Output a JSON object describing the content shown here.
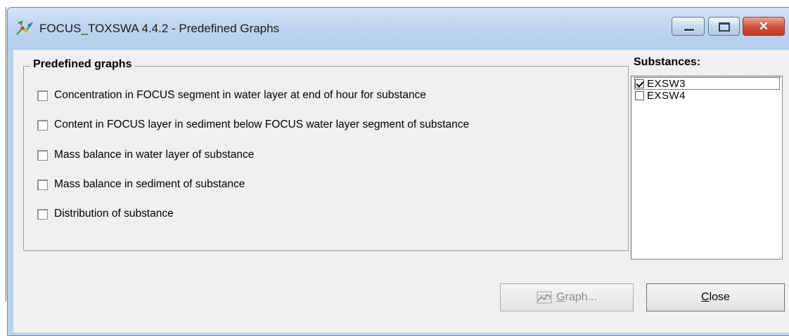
{
  "window": {
    "title": "FOCUS_TOXSWA 4.4.2 - Predefined Graphs",
    "controls": {
      "minimize": "minimize",
      "maximize": "maximize",
      "close": "✕"
    }
  },
  "predefined": {
    "group_label": "Predefined graphs",
    "options": [
      {
        "label": "Concentration in FOCUS segment in water layer at end of hour for substance",
        "checked": false
      },
      {
        "label": "Content in FOCUS layer in sediment below FOCUS water layer segment of substance",
        "checked": false
      },
      {
        "label": "Mass balance in water layer of substance",
        "checked": false
      },
      {
        "label": "Mass balance in sediment of substance",
        "checked": false
      },
      {
        "label": "Distribution of substance",
        "checked": false
      }
    ]
  },
  "substances": {
    "title": "Substances:",
    "items": [
      {
        "label": "EXSW3",
        "checked": true
      },
      {
        "label": "EXSW4",
        "checked": false
      }
    ]
  },
  "buttons": {
    "graph": {
      "mnemonic": "G",
      "rest": "raph...",
      "enabled": false
    },
    "close": {
      "mnemonic": "C",
      "rest": "lose",
      "enabled": true
    }
  },
  "colors": {
    "titlebar": "#bed5ee",
    "dialog_bg": "#f0f0f0",
    "close_button": "#c0391f",
    "disabled_text": "#8b8b8b"
  }
}
